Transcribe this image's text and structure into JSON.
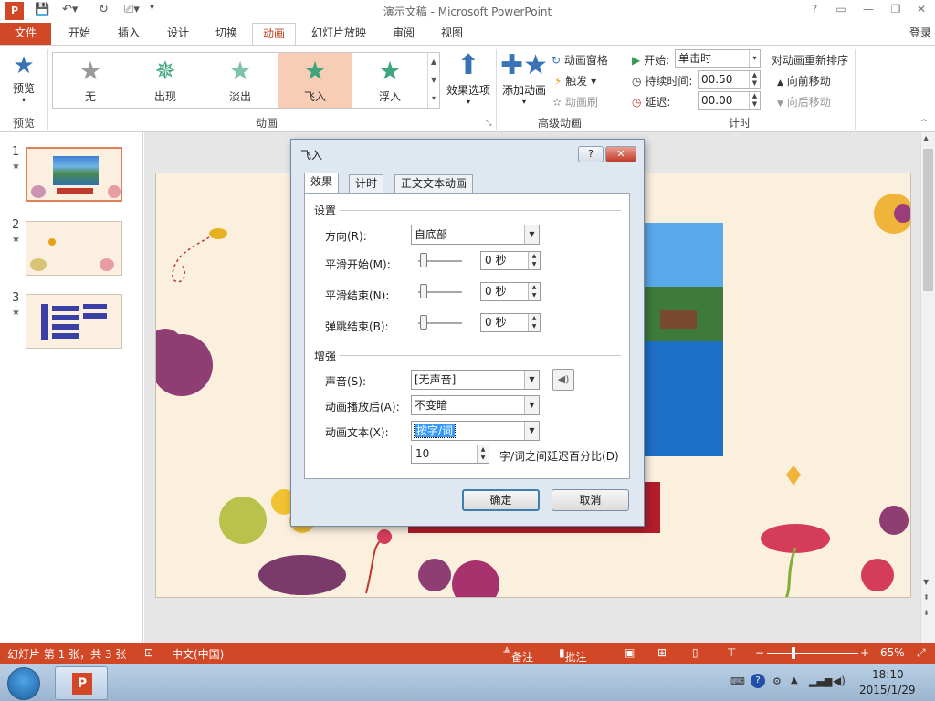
{
  "window": {
    "title": "演示文稿 - Microsoft PowerPoint",
    "controls": [
      "?",
      "▭",
      "—",
      "❐",
      "✕"
    ]
  },
  "tabs": {
    "file": "文件",
    "items": [
      "开始",
      "插入",
      "设计",
      "切换",
      "动画",
      "幻灯片放映",
      "审阅",
      "视图"
    ],
    "active": "动画",
    "login": "登录"
  },
  "ribbon": {
    "preview": {
      "label": "预览",
      "group": "预览"
    },
    "animation_group": "动画",
    "gallery": [
      "无",
      "出现",
      "淡出",
      "飞入",
      "浮入"
    ],
    "gallery_selected": "飞入",
    "effect_options": "效果选项",
    "add_animation": "添加动画",
    "anim_pane": "动画窗格",
    "trigger": "触发",
    "anim_painter": "动画刷",
    "advanced_group": "高级动画",
    "start_label": "开始:",
    "start_value": "单击时",
    "duration_label": "持续时间:",
    "duration_value": "00.50",
    "delay_label": "延迟:",
    "delay_value": "00.00",
    "timing_group": "计时",
    "reorder_title": "对动画重新排序",
    "move_earlier": "向前移动",
    "move_later": "向后移动"
  },
  "thumbnails": [
    {
      "num": "1",
      "star": "★"
    },
    {
      "num": "2",
      "star": "★"
    },
    {
      "num": "3",
      "star": "★"
    }
  ],
  "dialog": {
    "title": "飞入",
    "help": "?",
    "close": "✕",
    "tabs": [
      "效果",
      "计时",
      "正文文本动画"
    ],
    "settings_section": "设置",
    "direction_label": "方向(R):",
    "direction_value": "自底部",
    "smooth_start_label": "平滑开始(M):",
    "smooth_start_value": "0 秒",
    "smooth_end_label": "平滑结束(N):",
    "smooth_end_value": "0 秒",
    "bounce_end_label": "弹跳结束(B):",
    "bounce_end_value": "0 秒",
    "enhance_section": "增强",
    "sound_label": "声音(S):",
    "sound_value": "[无声音]",
    "after_label": "动画播放后(A):",
    "after_value": "不变暗",
    "text_label": "动画文本(X):",
    "text_value": "按字/词",
    "delay_value": "10",
    "delay_label": "字/词之间延迟百分比(D)",
    "ok": "确定",
    "cancel": "取消"
  },
  "statusbar": {
    "slide_info": "幻灯片 第 1 张，共 3 张",
    "language": "中文(中国)",
    "notes": "备注",
    "comments": "批注",
    "zoom": "65%"
  },
  "taskbar": {
    "time": "18:10",
    "date": "2015/1/29"
  },
  "colors": {
    "accent": "#d24726",
    "gallery_selected": "#f8cdb6",
    "dialog_bg": "#dfe7f1"
  }
}
